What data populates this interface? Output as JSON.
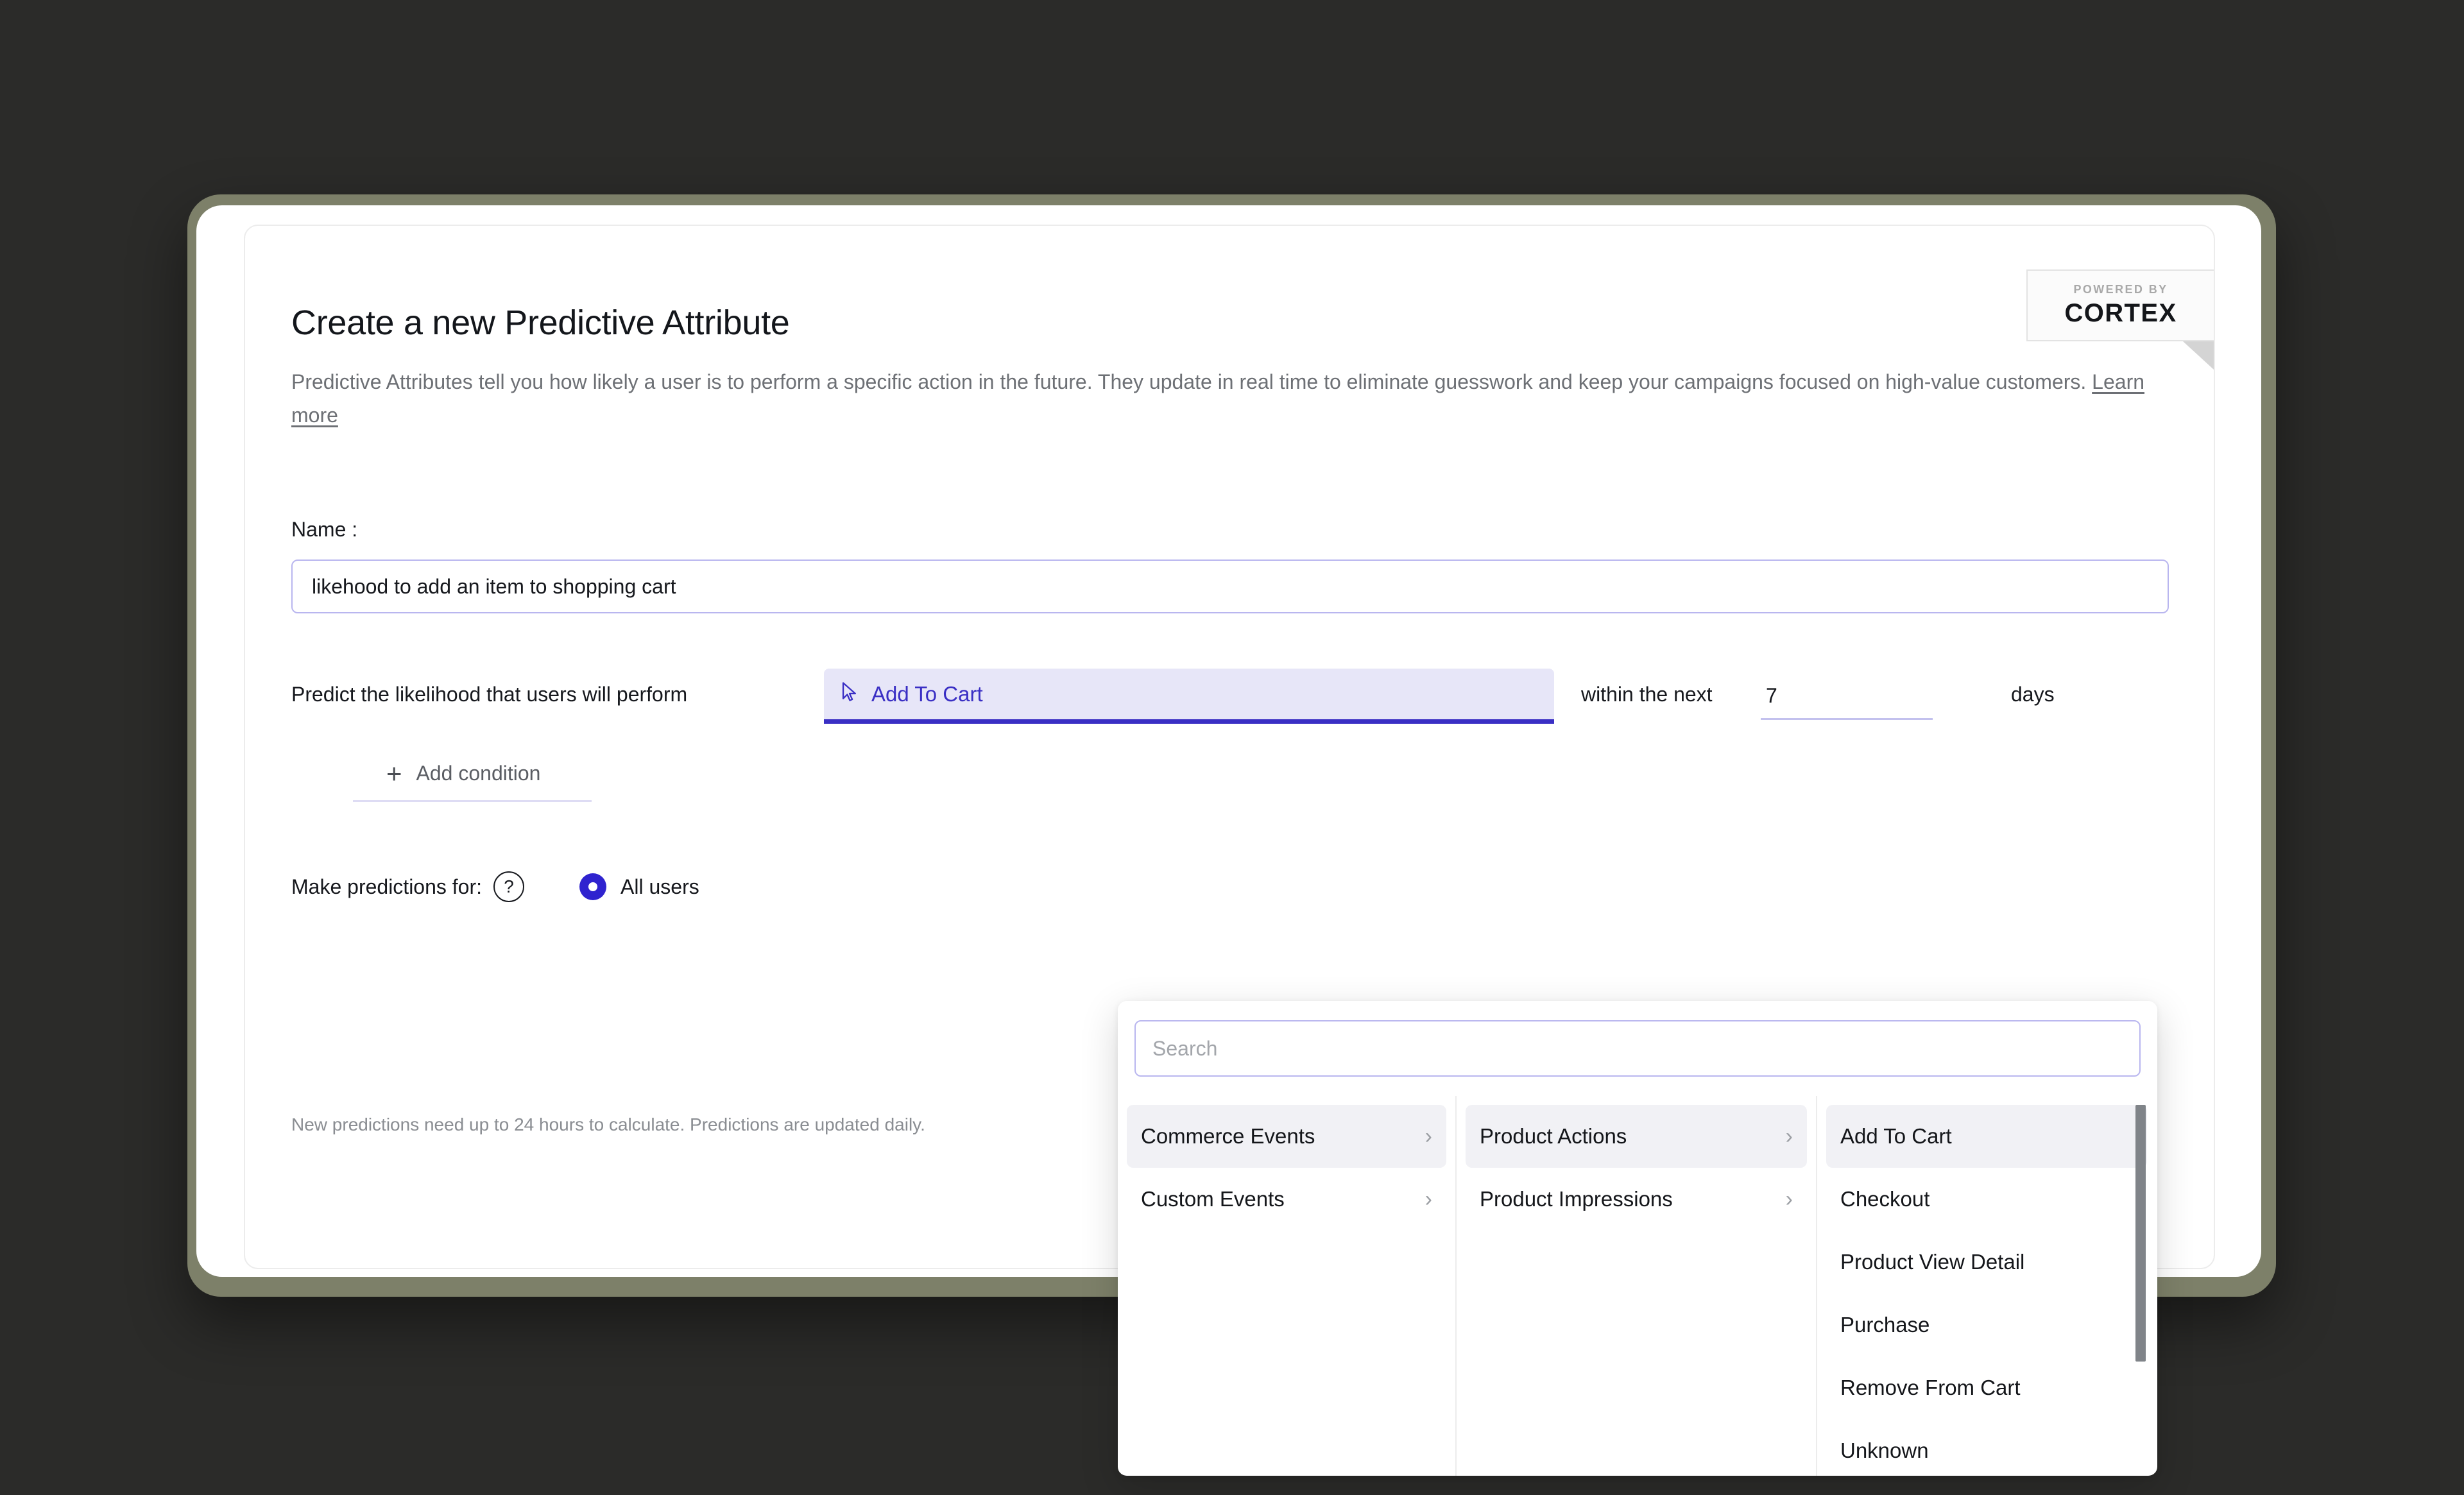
{
  "badge": {
    "powered_by": "POWERED BY",
    "brand": "CORTEX"
  },
  "page_title": "Create a new Predictive Attribute",
  "description": {
    "text": "Predictive Attributes tell you how likely a user is to perform a specific action in the future. They update in real time to eliminate guesswork and keep your campaigns focused on high-value customers. ",
    "link_label": "Learn more"
  },
  "name_field": {
    "label": "Name :",
    "value": "likehood to add an item to shopping cart",
    "placeholder": "Name"
  },
  "predict_row": {
    "prefix_label": "Predict the likelihood that users will perform",
    "event_value": "Add To Cart",
    "event_icon": "cursor-pointer-icon",
    "within_label": "within the next",
    "days_value": "7",
    "days_placeholder": "7",
    "days_unit": "days"
  },
  "add_condition": {
    "icon": "plus-icon",
    "label": "Add condition"
  },
  "predictions_for": {
    "label": "Make predictions for:",
    "help_icon": "question-mark-icon",
    "option_label": "All users",
    "option_selected": true
  },
  "footer_note": "New predictions need up to 24 hours to calculate. Predictions are updated daily.",
  "dropdown": {
    "search_placeholder": "Search",
    "columns": [
      {
        "name": "categories",
        "items": [
          {
            "label": "Commerce Events",
            "has_chevron": true,
            "selected": true
          },
          {
            "label": "Custom Events",
            "has_chevron": true,
            "selected": false
          }
        ]
      },
      {
        "name": "subcategories",
        "items": [
          {
            "label": "Product Actions",
            "has_chevron": true,
            "selected": true
          },
          {
            "label": "Product Impressions",
            "has_chevron": true,
            "selected": false
          }
        ]
      },
      {
        "name": "events",
        "items": [
          {
            "label": "Add To Cart",
            "has_chevron": false,
            "selected": true
          },
          {
            "label": "Checkout",
            "has_chevron": false,
            "selected": false
          },
          {
            "label": "Product View Detail",
            "has_chevron": false,
            "selected": false
          },
          {
            "label": "Purchase",
            "has_chevron": false,
            "selected": false
          },
          {
            "label": "Remove From Cart",
            "has_chevron": false,
            "selected": false
          },
          {
            "label": "Unknown",
            "has_chevron": false,
            "selected": false
          }
        ]
      }
    ]
  },
  "colors": {
    "background": "#2b2b29",
    "frame": "#7d8069",
    "accent_purple": "#3a2fc4",
    "accent_purple_light": "#e7e6f8",
    "radio_blue": "#2f23cf",
    "border_light": "#ececec",
    "text_primary": "#16181d",
    "text_muted": "#6d7075"
  }
}
